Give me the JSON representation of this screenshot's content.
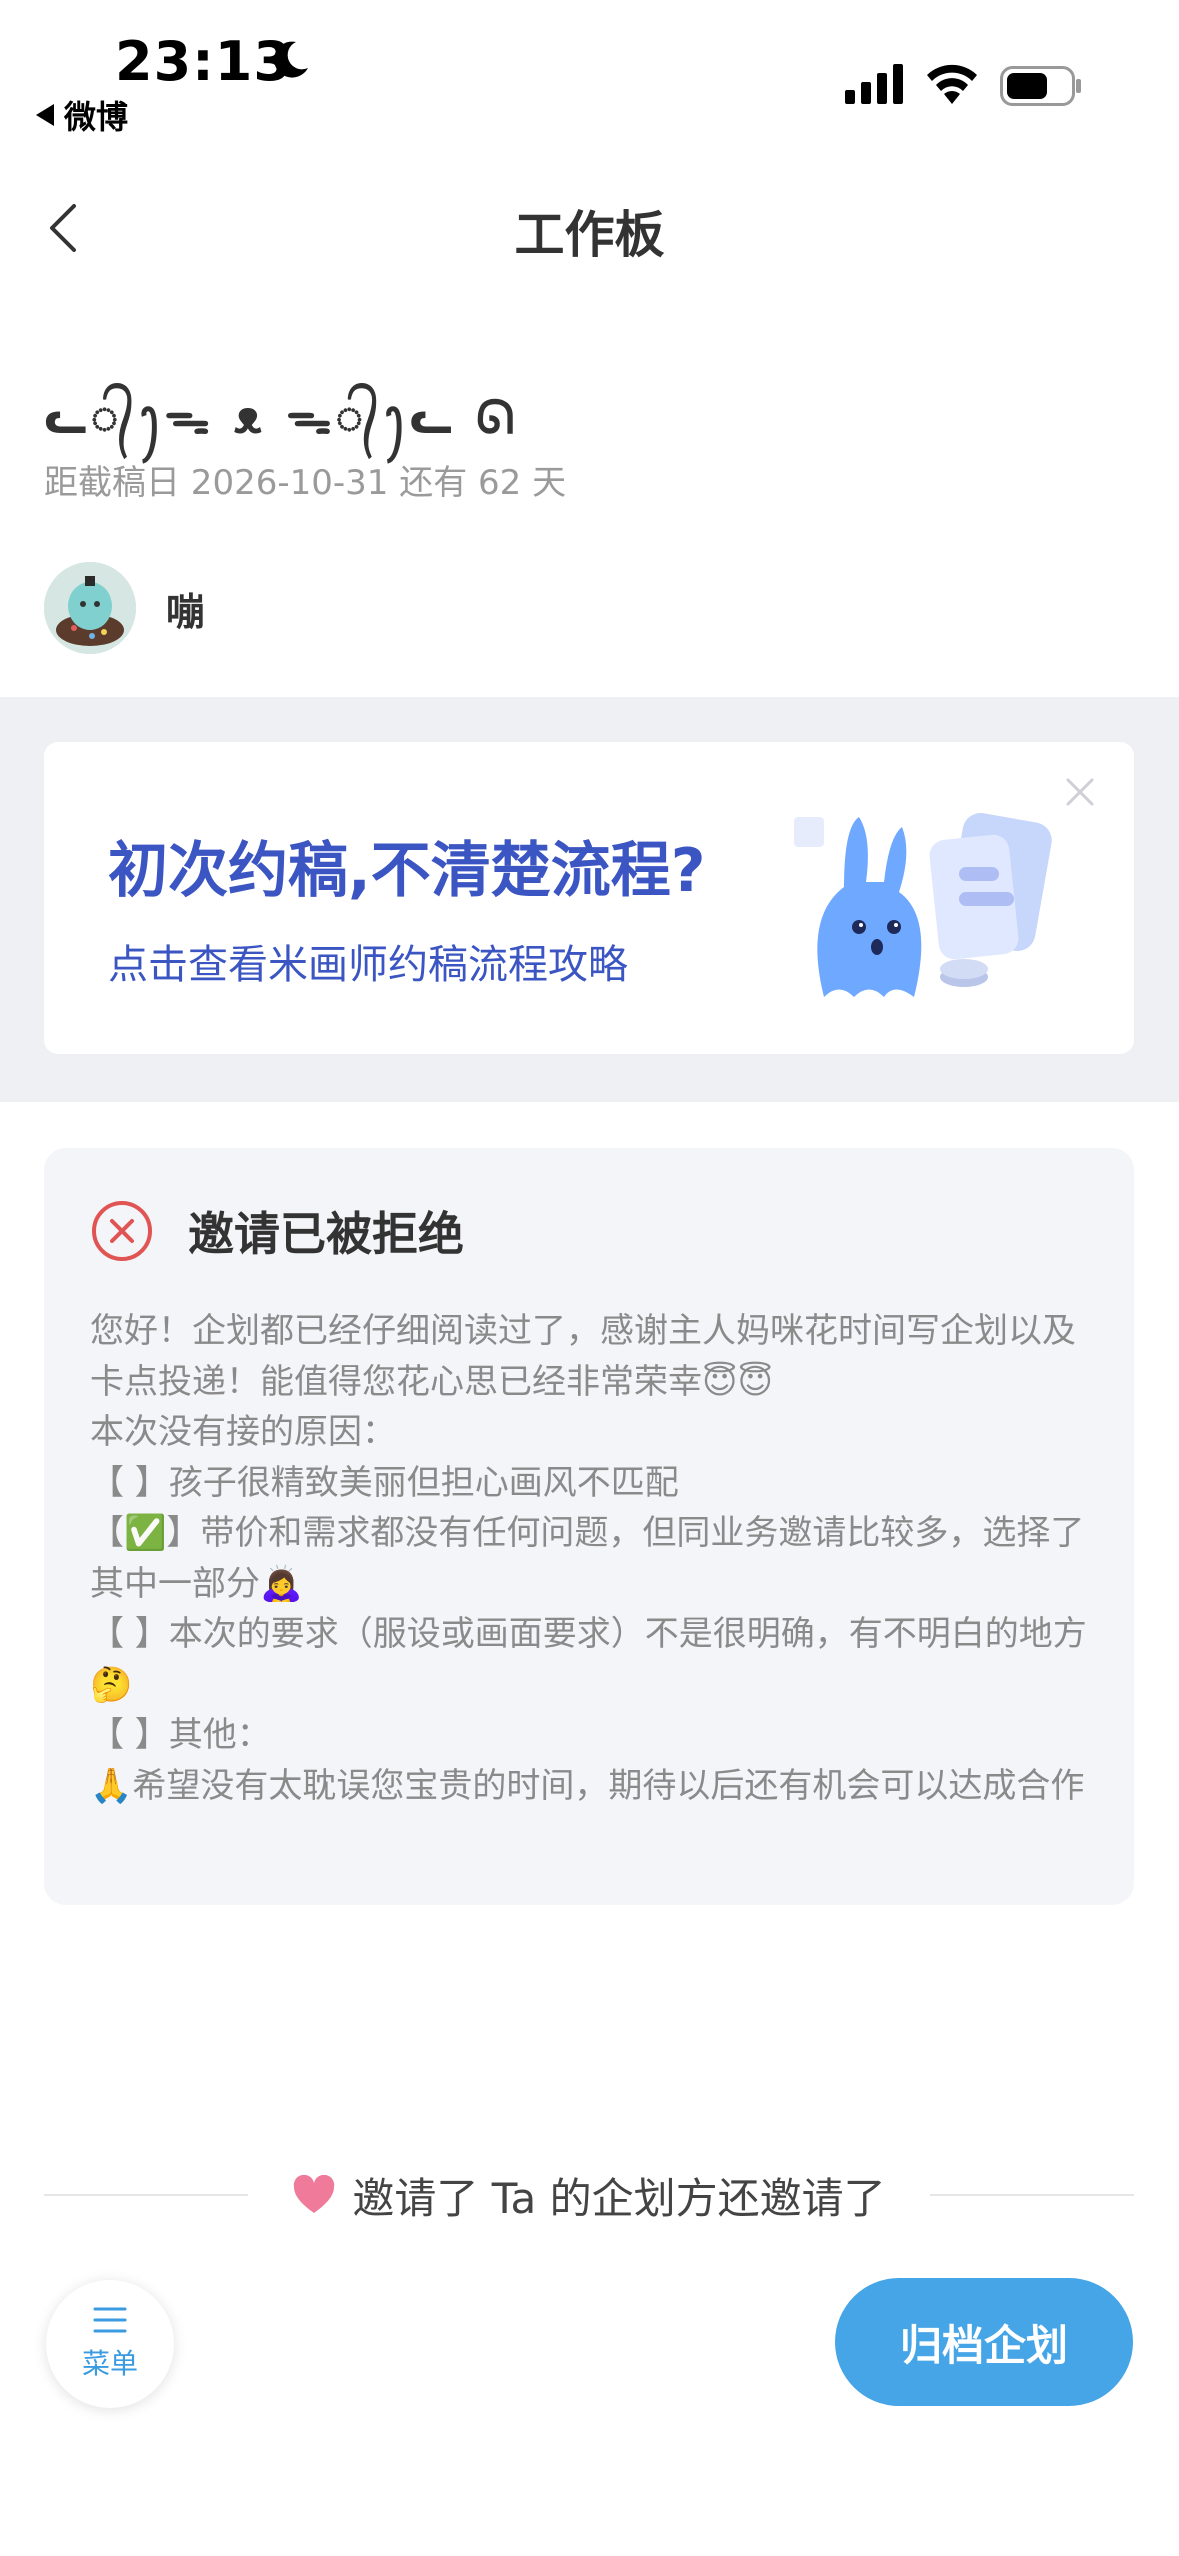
{
  "status_bar": {
    "time": "23:13",
    "back_app": "微博",
    "icons": [
      "moon-icon",
      "signal-icon",
      "wifi-icon",
      "battery-icon"
    ]
  },
  "nav": {
    "title": "工作板"
  },
  "project": {
    "title": "ᓚ᭄ꫂᯓ ᴥ ᯓ᭄ꫂᓚ ᘏ",
    "deadline": "距截稿日 2026-10-31 还有 62 天",
    "user_name": "嘣"
  },
  "banner": {
    "title": "初次约稿,不清楚流程?",
    "subtitle": "点击查看米画师约稿流程攻略"
  },
  "rejection": {
    "title": "邀请已被拒绝",
    "lines": [
      "您好！企划都已经仔细阅读过了，感谢主人妈咪花时间写企划以及卡点投递！能值得您花心思已经非常荣幸😇😇",
      "本次没有接的原因：",
      "【 】孩子很精致美丽但担心画风不匹配",
      "【✅】带价和需求都没有任何问题，但同业务邀请比较多，选择了其中一部分🙇‍♀️",
      "【 】本次的要求（服设或画面要求）不是很明确，有不明白的地方🤔",
      "【 】其他：",
      "🙏希望没有太耽误您宝贵的时间，期待以后还有机会可以达成合作"
    ]
  },
  "divider": {
    "text": "邀请了 Ta 的企划方还邀请了"
  },
  "bottom": {
    "menu_label": "菜单",
    "archive_label": "归档企划"
  },
  "colors": {
    "accent_blue": "#46a5e6",
    "banner_blue": "#3b55c2",
    "reject_red": "#e05454",
    "heart_pink": "#f07a9a"
  }
}
